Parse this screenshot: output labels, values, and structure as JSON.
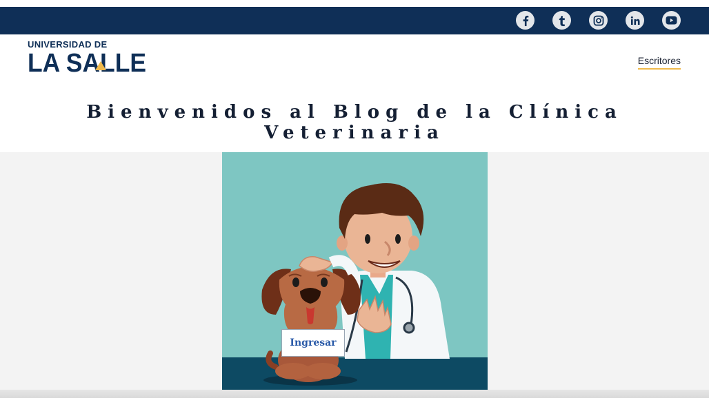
{
  "header": {
    "social": [
      {
        "name": "facebook",
        "icon": "facebook-icon"
      },
      {
        "name": "tumblr",
        "icon": "tumblr-icon"
      },
      {
        "name": "instagram",
        "icon": "instagram-icon"
      },
      {
        "name": "linkedin",
        "icon": "linkedin-icon"
      },
      {
        "name": "youtube",
        "icon": "youtube-icon"
      }
    ],
    "logo_top": "UNIVERSIDAD DE",
    "logo_main": "LA SALLE",
    "nav_link": "Escritores"
  },
  "main": {
    "title": "Bienvenidos al Blog de la Clínica Veterinaria",
    "button_label": "Ingresar"
  },
  "colors": {
    "topbar": "#0f2f57",
    "accent": "#f0b94a",
    "hero_bg": "#7ec6c2",
    "table": "#0d4a63"
  }
}
